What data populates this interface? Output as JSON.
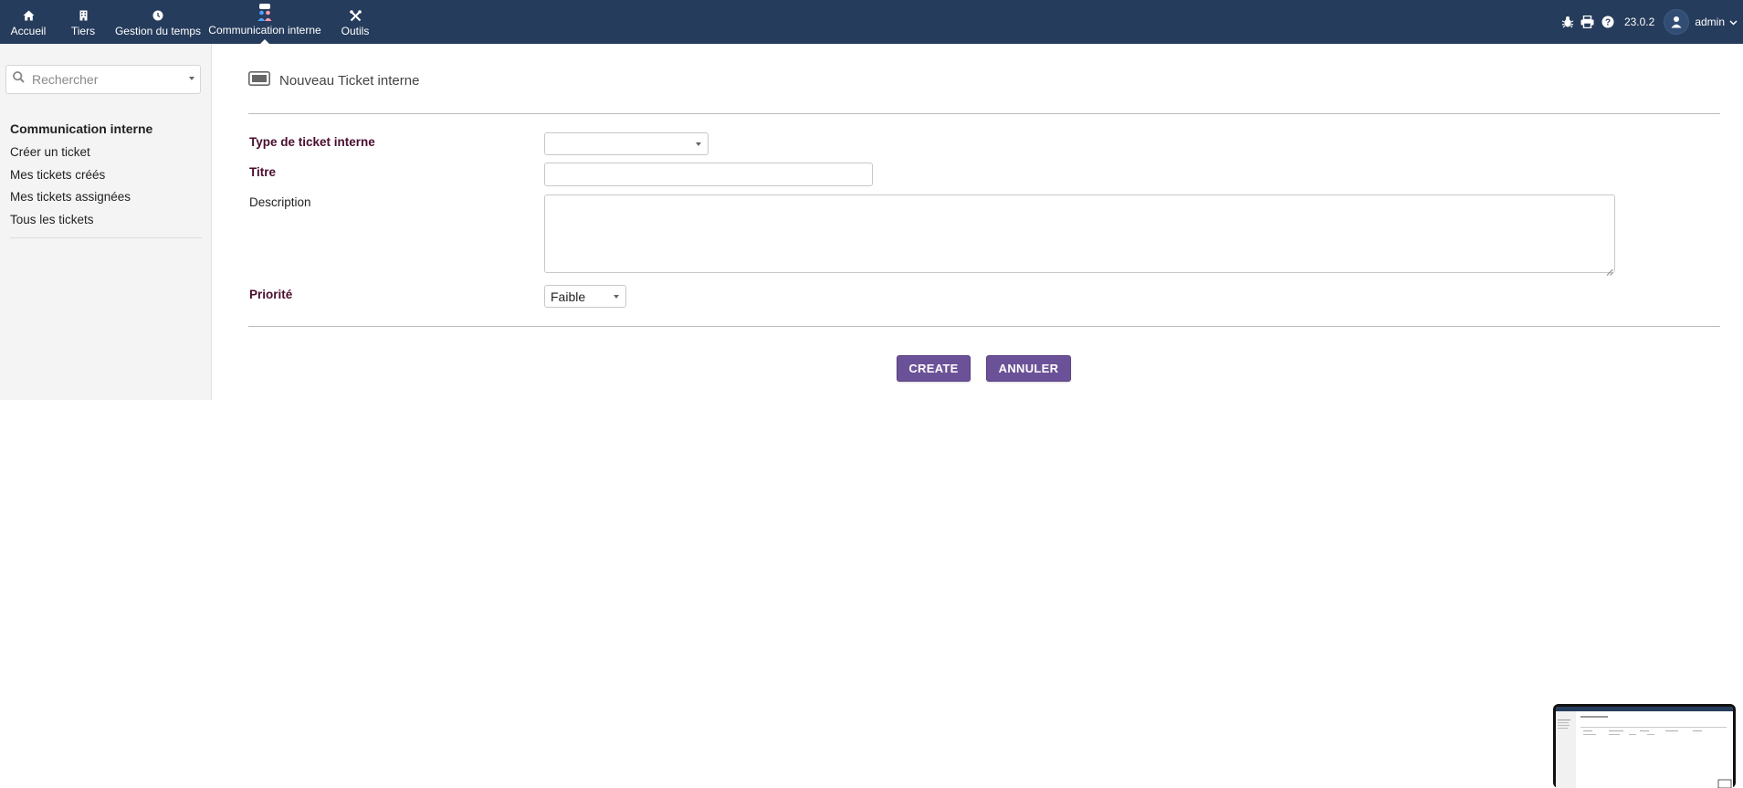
{
  "topnav": {
    "items": [
      {
        "label": "Accueil",
        "icon": "home-icon"
      },
      {
        "label": "Tiers",
        "icon": "building-icon"
      },
      {
        "label": "Gestion du temps",
        "icon": "clock-icon"
      },
      {
        "label": "Communication interne",
        "icon": "ticket-users-icon",
        "active": true
      },
      {
        "label": "Outils",
        "icon": "tools-icon"
      }
    ],
    "version": "23.0.2",
    "user": "admin",
    "right_icons": [
      "bug-icon",
      "print-icon",
      "help-icon"
    ]
  },
  "sidebar": {
    "search_placeholder": "Rechercher",
    "section_title": "Communication interne",
    "links": [
      {
        "label": "Créer un ticket"
      },
      {
        "label": "Mes tickets créés"
      },
      {
        "label": "Mes tickets assignées"
      },
      {
        "label": "Tous les tickets"
      }
    ]
  },
  "page": {
    "title": "Nouveau Ticket interne",
    "fields": {
      "type_label": "Type de ticket interne",
      "type_value": "",
      "titre_label": "Titre",
      "titre_value": "",
      "description_label": "Description",
      "description_value": "",
      "priorite_label": "Priorité",
      "priorite_value": "Faible"
    },
    "buttons": {
      "create": "CREATE",
      "cancel": "ANNULER"
    }
  },
  "colors": {
    "topbar": "#263c5c",
    "button": "#6b5197",
    "required_label": "#4a0d2e"
  }
}
